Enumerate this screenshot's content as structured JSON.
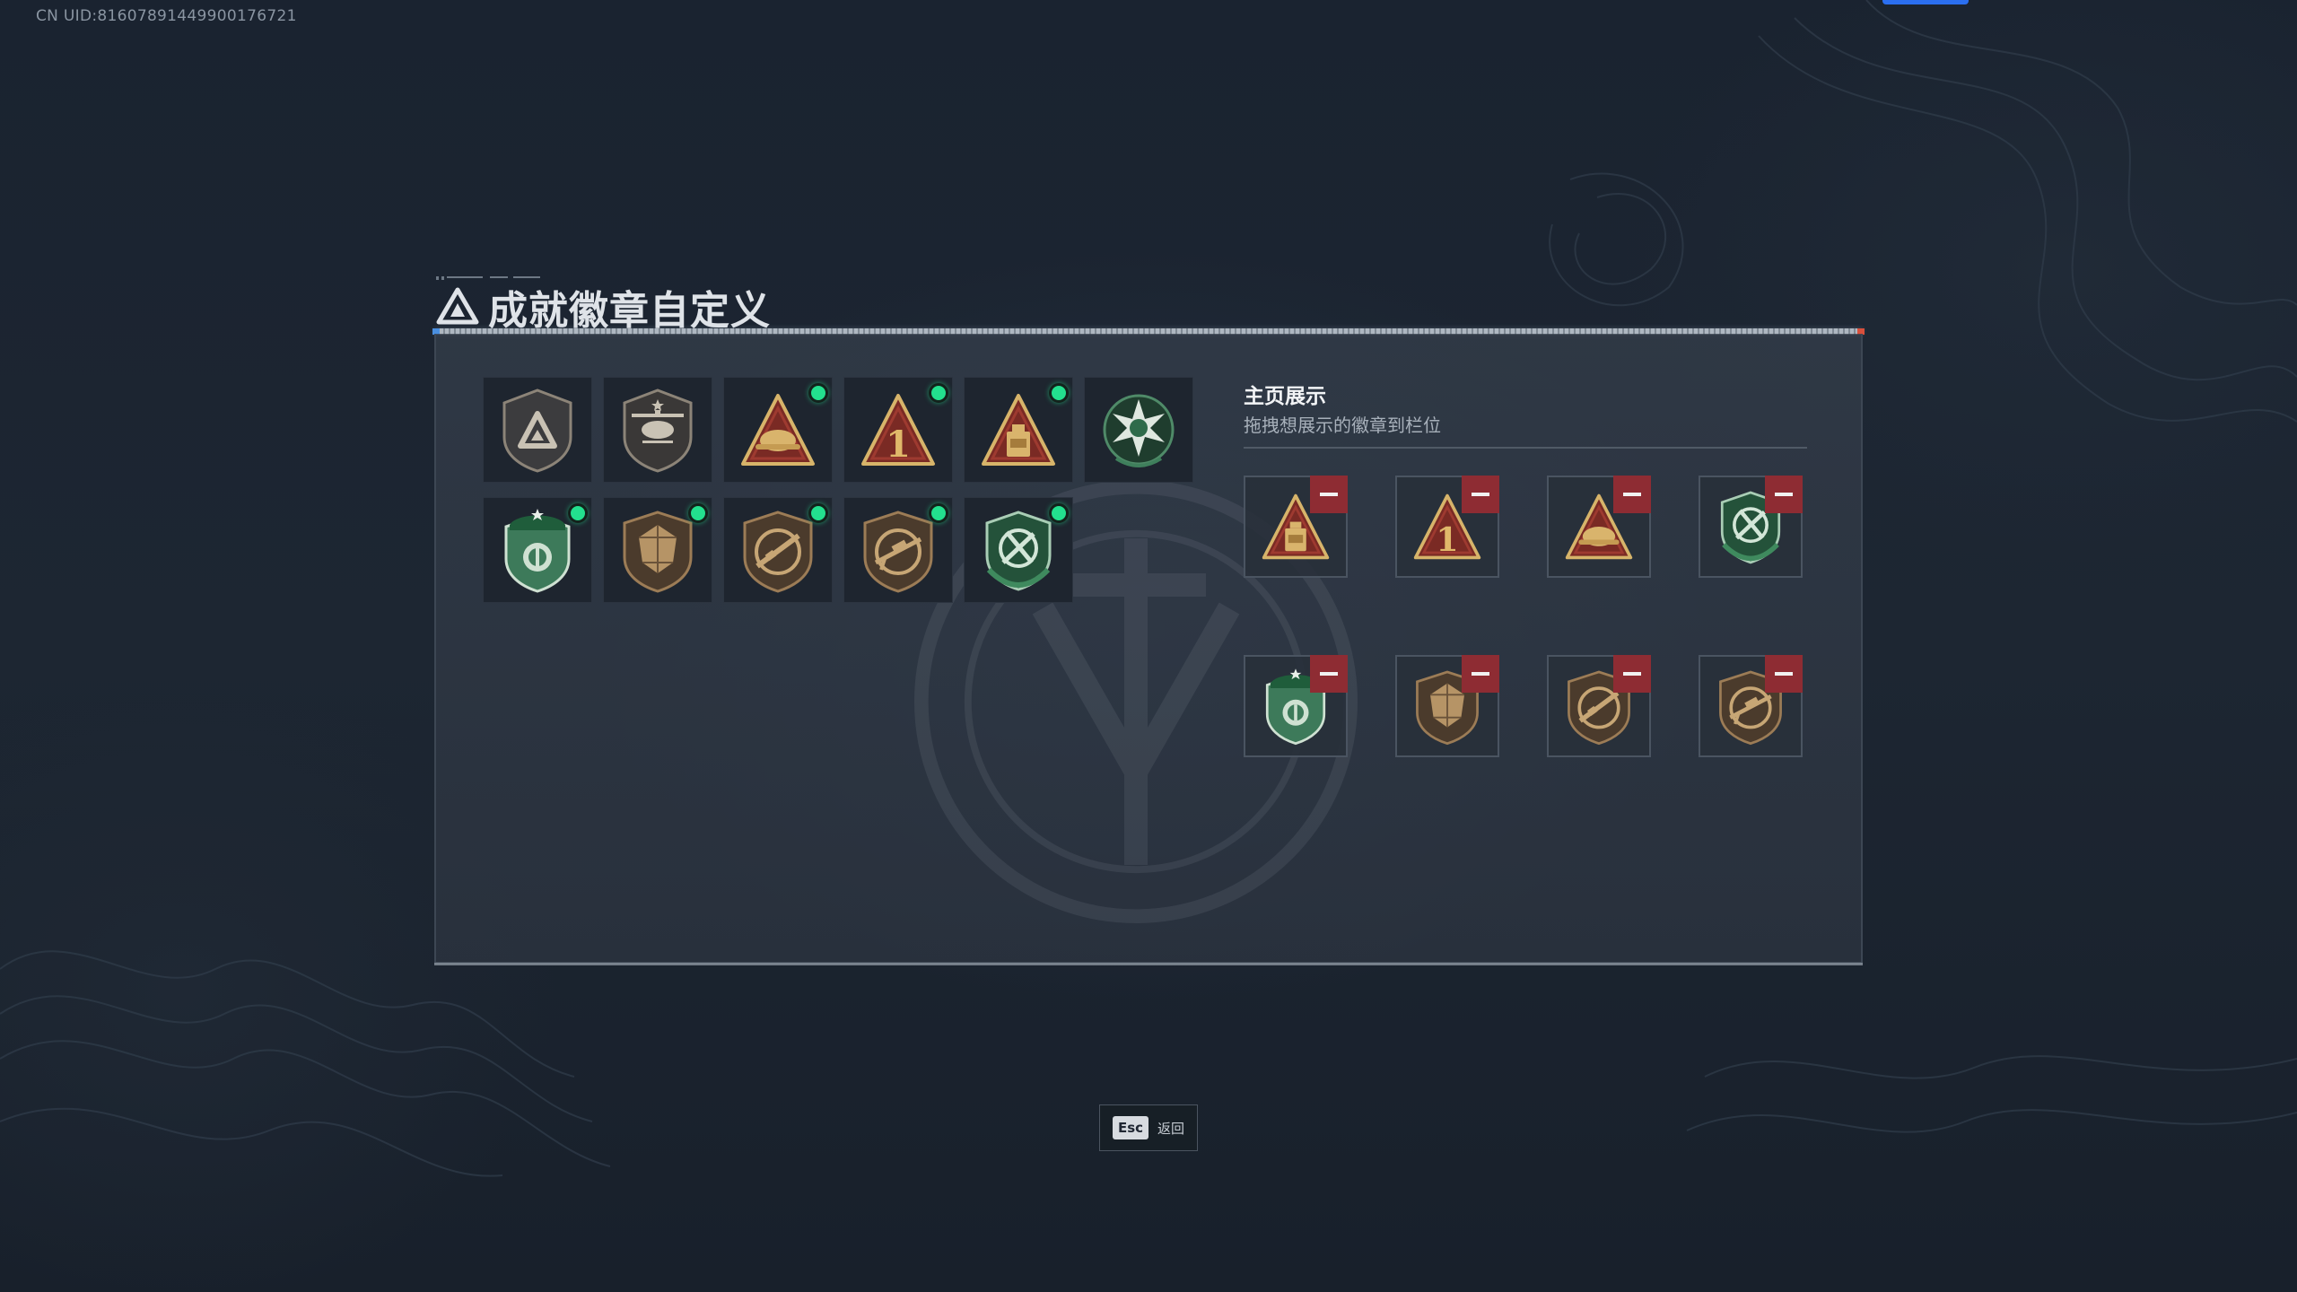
{
  "uid_label": "CN UID:816078914499001767​21",
  "page": {
    "title": "成就徽章自定义"
  },
  "badges": [
    {
      "icon": "tri-shield-icon",
      "selected": false
    },
    {
      "icon": "helicopter-shield-icon",
      "selected": false
    },
    {
      "icon": "tri-helmet-icon",
      "selected": true
    },
    {
      "icon": "tri-number-one-icon",
      "selected": true
    },
    {
      "icon": "tri-bottle-icon",
      "selected": true
    },
    {
      "icon": "green-star-wreath-icon",
      "selected": false
    },
    {
      "icon": "green-beret-shield-icon",
      "selected": true
    },
    {
      "icon": "bronze-gem-shield-icon",
      "selected": true
    },
    {
      "icon": "bronze-rifle-shield-icon",
      "selected": true
    },
    {
      "icon": "bronze-sniper-shield-icon",
      "selected": true
    },
    {
      "icon": "green-wreath-arrows-shield-icon",
      "selected": true
    }
  ],
  "showcase": {
    "title": "主页展示",
    "subtitle": "拖拽想展示的徽章到栏位",
    "slots": [
      {
        "icon": "tri-bottle-icon"
      },
      {
        "icon": "tri-number-one-icon"
      },
      {
        "icon": "tri-helmet-icon"
      },
      {
        "icon": "green-wreath-arrows-shield-icon"
      },
      {
        "icon": "green-beret-shield-icon"
      },
      {
        "icon": "bronze-gem-shield-icon"
      },
      {
        "icon": "bronze-rifle-shield-icon"
      },
      {
        "icon": "bronze-sniper-shield-icon"
      }
    ]
  },
  "esc": {
    "key": "Esc",
    "label": "返回"
  },
  "colors": {
    "selected_dot": "#23e08e",
    "remove": "#8e2c33",
    "accent_blue": "#2b6ff0"
  }
}
